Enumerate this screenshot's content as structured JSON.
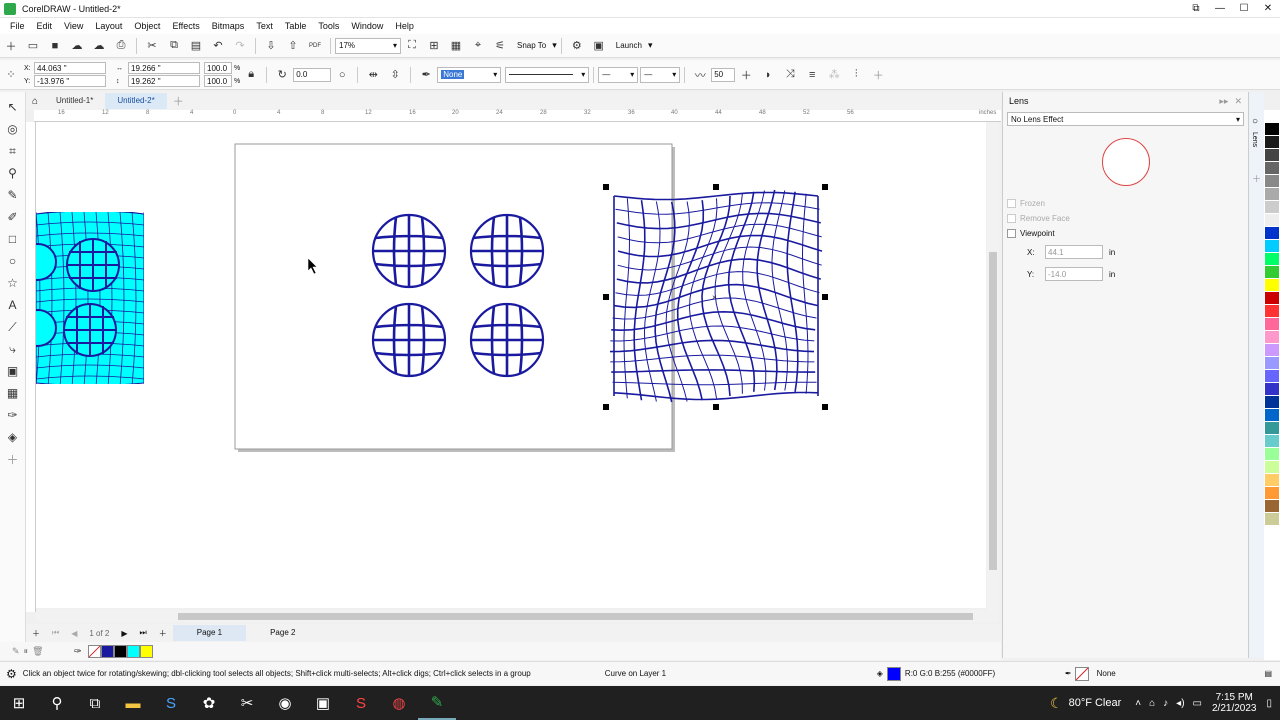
{
  "window": {
    "title": "CorelDRAW - Untitled-2*",
    "min": "—",
    "max": "☐",
    "close": "✕",
    "restore": "⧉"
  },
  "menu": [
    "File",
    "Edit",
    "View",
    "Layout",
    "Object",
    "Effects",
    "Bitmaps",
    "Text",
    "Table",
    "Tools",
    "Window",
    "Help"
  ],
  "standard_toolbar": {
    "zoom": "17%",
    "snap_label": "Snap To",
    "launch_label": "Launch",
    "pdf_label": "PDF"
  },
  "property_bar": {
    "x": "44.063 \"",
    "y": "-13.976 \"",
    "width": "19.266 \"",
    "height": "19.262 \"",
    "scale_x": "100.0",
    "scale_y": "100.0",
    "percent": "%",
    "rotation": "0.0",
    "fill_none": "None",
    "curve_smooth": "50"
  },
  "doc_tabs": [
    "Untitled-1*",
    "Untitled-2*"
  ],
  "ruler": {
    "labels": [
      "16",
      "12",
      "8",
      "4",
      "0",
      "4",
      "8",
      "12",
      "16",
      "20",
      "24",
      "28",
      "32",
      "36",
      "40",
      "44",
      "48",
      "52",
      "56"
    ],
    "unit": "inches"
  },
  "page_nav": {
    "counter": "1 of 2",
    "pages": [
      "Page 1",
      "Page 2"
    ]
  },
  "docker": {
    "title": "Lens",
    "effect": "No Lens Effect",
    "frozen": "Frozen",
    "remove_face": "Remove Face",
    "viewpoint": "Viewpoint",
    "vx_label": "X:",
    "vx_value": "44.1",
    "vx_unit": "in",
    "vy_label": "Y:",
    "vy_value": "-14.0",
    "vy_unit": "in",
    "strip_label": "Lens"
  },
  "status": {
    "hint": "Click an object twice for rotating/skewing; dbl-clicking tool selects all objects; Shift+click multi-selects; Alt+click digs; Ctrl+click selects in a group",
    "object": "Curve on Layer 1",
    "fill_info": "R:0 G:0 B:255 (#0000FF)",
    "outline": "None"
  },
  "taskbar": {
    "weather": "80°F  Clear",
    "time": "7:15 PM",
    "date": "2/21/2023"
  },
  "colors": {
    "accent": "#0000ff",
    "cyan": "#00ffff",
    "navy": "#1a1aa0"
  },
  "palette": [
    "#ffffff",
    "#000000",
    "#1a1a1a",
    "#444444",
    "#666666",
    "#888888",
    "#aaaaaa",
    "#cccccc",
    "#eeeeee",
    "#0033cc",
    "#00ccff",
    "#00ff66",
    "#33cc33",
    "#ffff00",
    "#cc0000",
    "#ff3333",
    "#ff6699",
    "#ff99cc",
    "#cc99ff",
    "#9999ff",
    "#6666ff",
    "#3333cc",
    "#003399",
    "#0066cc",
    "#339999",
    "#66cccc",
    "#99ff99",
    "#ccff99",
    "#ffcc66",
    "#ff9933",
    "#996633",
    "#cccc99"
  ]
}
